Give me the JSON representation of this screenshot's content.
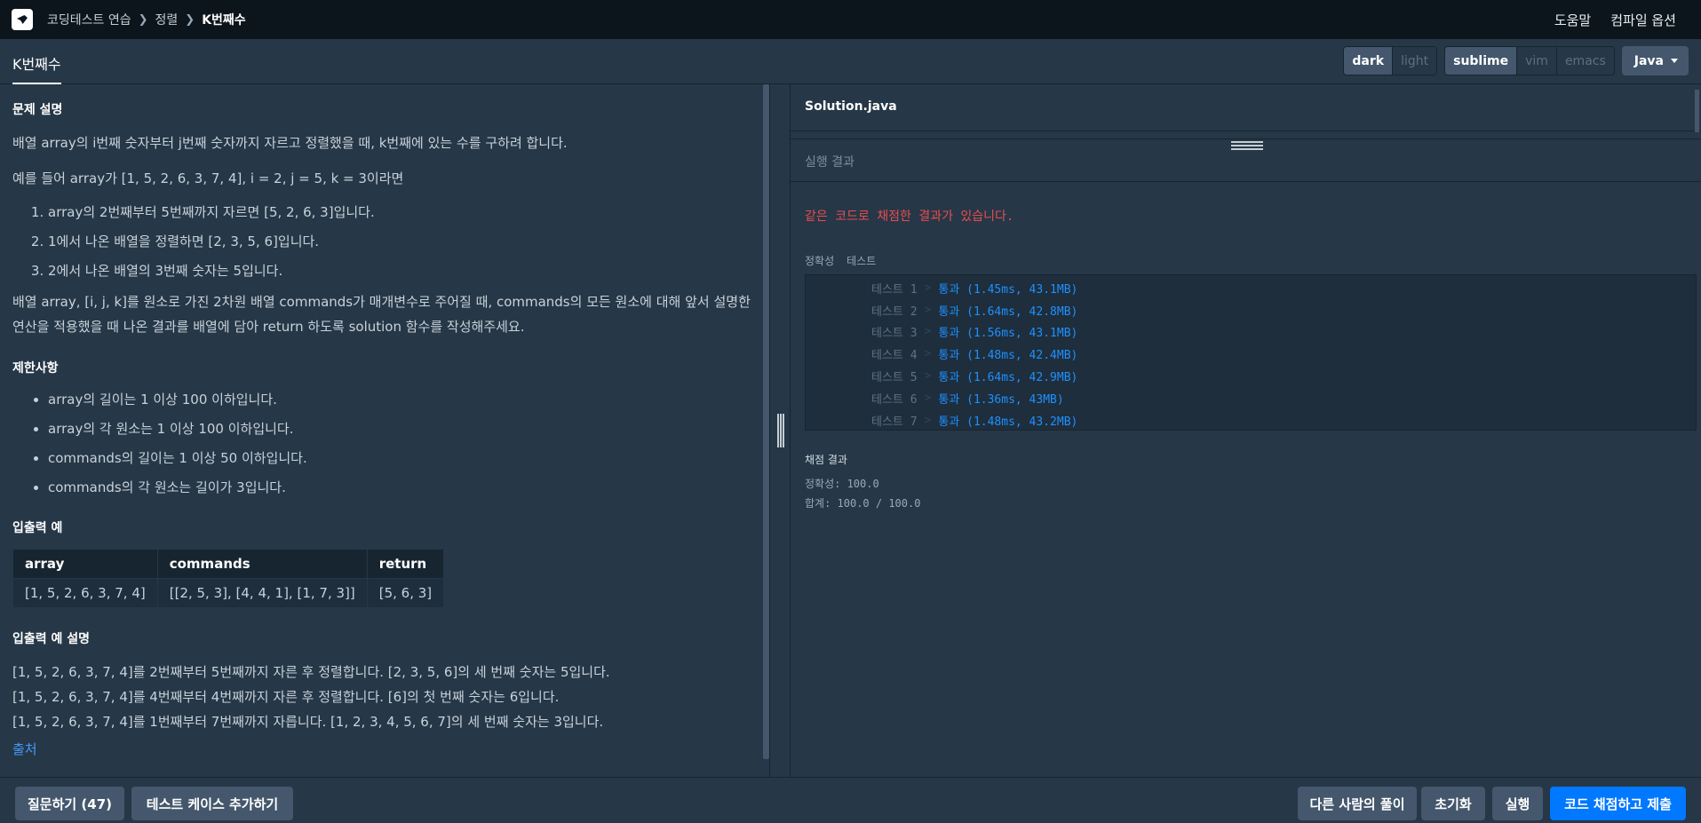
{
  "nav": {
    "breadcrumb": [
      "코딩테스트 연습",
      "정렬",
      "K번째수"
    ],
    "help": "도움말",
    "compile_options": "컴파일 옵션"
  },
  "tabbar": {
    "tab_label": "K번째수",
    "theme": [
      "dark",
      "light"
    ],
    "theme_selected": "dark",
    "keymap": [
      "sublime",
      "vim",
      "emacs"
    ],
    "keymap_selected": "sublime",
    "language": "Java"
  },
  "problem": {
    "desc_title": "문제 설명",
    "desc_1": "배열 array의 i번째 숫자부터 j번째 숫자까지 자르고 정렬했을 때, k번째에 있는 수를 구하려 합니다.",
    "desc_2": "예를 들어 array가 [1, 5, 2, 6, 3, 7, 4], i = 2, j = 5, k = 3이라면",
    "steps": [
      "array의 2번째부터 5번째까지 자르면 [5, 2, 6, 3]입니다.",
      "1에서 나온 배열을 정렬하면 [2, 3, 5, 6]입니다.",
      "2에서 나온 배열의 3번째 숫자는 5입니다."
    ],
    "desc_3": "배열 array, [i, j, k]를 원소로 가진 2차원 배열 commands가 매개변수로 주어질 때, commands의 모든 원소에 대해 앞서 설명한 연산을 적용했을 때 나온 결과를 배열에 담아 return 하도록 solution 함수를 작성해주세요.",
    "constraints_title": "제한사항",
    "constraints": [
      "array의 길이는 1 이상 100 이하입니다.",
      "array의 각 원소는 1 이상 100 이하입니다.",
      "commands의 길이는 1 이상 50 이하입니다.",
      "commands의 각 원소는 길이가 3입니다."
    ],
    "io_title": "입출력 예",
    "io_headers": [
      "array",
      "commands",
      "return"
    ],
    "io_row": [
      "[1, 5, 2, 6, 3, 7, 4]",
      "[[2, 5, 3], [4, 4, 1], [1, 7, 3]]",
      "[5, 6, 3]"
    ],
    "io_explain_title": "입출력 예 설명",
    "io_explain": [
      "[1, 5, 2, 6, 3, 7, 4]를 2번째부터 5번째까지 자른 후 정렬합니다. [2, 3, 5, 6]의 세 번째 숫자는 5입니다.",
      "[1, 5, 2, 6, 3, 7, 4]를 4번째부터 4번째까지 자른 후 정렬합니다. [6]의 첫 번째 숫자는 6입니다.",
      "[1, 5, 2, 6, 3, 7, 4]를 1번째부터 7번째까지 자릅니다. [1, 2, 3, 4, 5, 6, 7]의 세 번째 숫자는 3입니다."
    ],
    "source_link": "출처"
  },
  "editor": {
    "filename": "Solution.java",
    "result_title": "실행 결과"
  },
  "results": {
    "same_code_message": "같은 코드로 채점한 결과가 있습니다.",
    "subtabs": [
      "정확성",
      "테스트"
    ],
    "tests": [
      {
        "label": "테스트 1",
        "result": "통과 (1.45ms, 43.1MB)"
      },
      {
        "label": "테스트 2",
        "result": "통과 (1.64ms, 42.8MB)"
      },
      {
        "label": "테스트 3",
        "result": "통과 (1.56ms, 43.1MB)"
      },
      {
        "label": "테스트 4",
        "result": "통과 (1.48ms, 42.4MB)"
      },
      {
        "label": "테스트 5",
        "result": "통과 (1.64ms, 42.9MB)"
      },
      {
        "label": "테스트 6",
        "result": "통과 (1.36ms, 43MB)"
      },
      {
        "label": "테스트 7",
        "result": "통과 (1.48ms, 43.2MB)"
      }
    ],
    "test_separator": ">",
    "score_title": "채점 결과",
    "accuracy": "정확성: 100.0",
    "total": "합계: 100.0 / 100.0"
  },
  "bottom": {
    "ask": "질문하기 (47)",
    "add_testcase": "테스트 케이스 추가하기",
    "others_solution": "다른 사람의 풀이",
    "reset": "초기화",
    "run": "실행",
    "submit": "코드 채점하고 제출"
  },
  "colors": {
    "background": "#263747",
    "topnav": "#0c151c",
    "primary": "#0078ff",
    "error": "#e84c4f",
    "pass": "#1e90ff"
  }
}
